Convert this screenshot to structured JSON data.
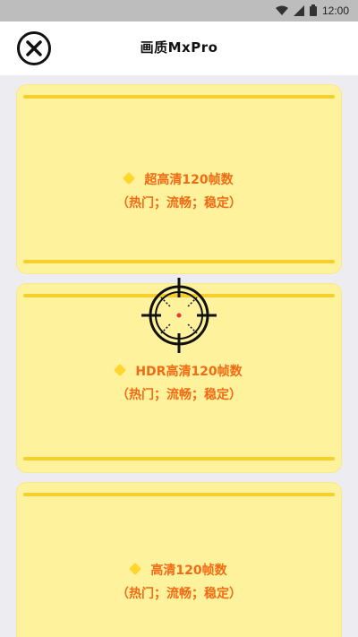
{
  "status_bar": {
    "time": "12:00"
  },
  "header": {
    "title": "画质MxPro"
  },
  "options": [
    {
      "title": "超高清120帧数",
      "subtitle": "（热门；流畅；稳定）"
    },
    {
      "title": "HDR高清120帧数",
      "subtitle": "（热门；流畅；稳定）"
    },
    {
      "title": "高清120帧数",
      "subtitle": "（热门；流畅；稳定）"
    }
  ],
  "colors": {
    "card_bg": "#fff29d",
    "card_line": "#f6cf2a",
    "text_orange": "#f26b14",
    "bullet": "#ffd52e"
  },
  "icons": [
    "wifi-icon",
    "signal-icon",
    "battery-icon",
    "close-icon",
    "crosshair-icon",
    "diamond-bullet-icon"
  ]
}
